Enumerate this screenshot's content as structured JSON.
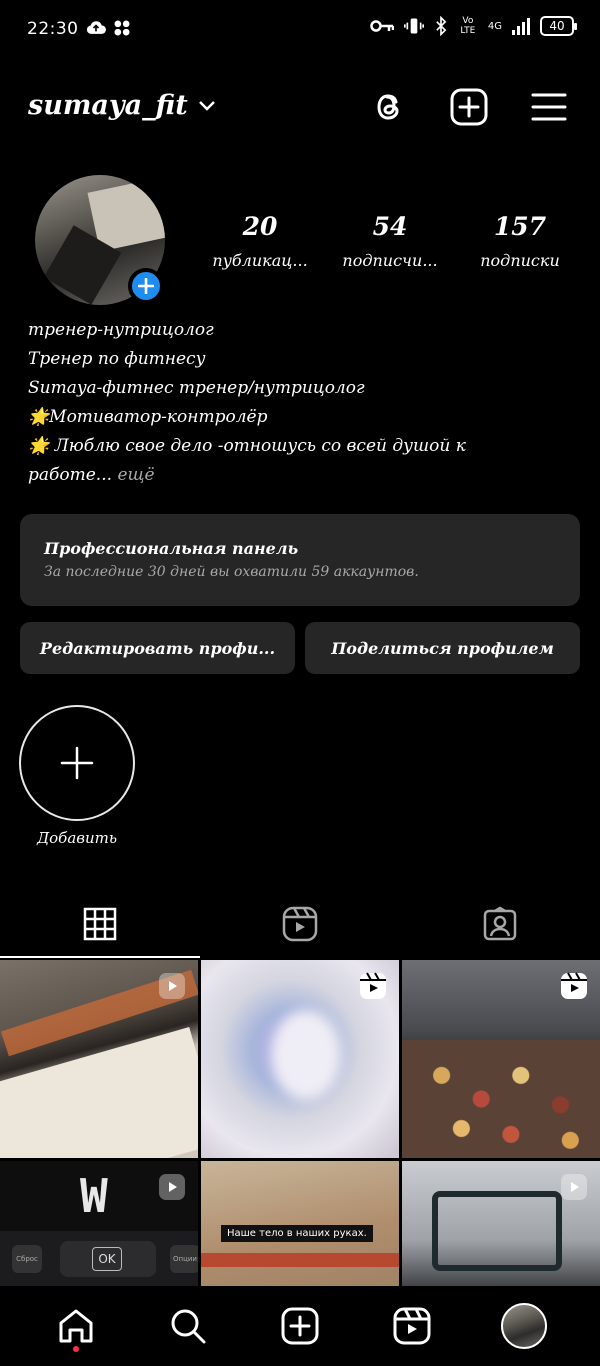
{
  "status_bar": {
    "time": "22:30",
    "network_type": "4G",
    "volte": "Vo LTE",
    "battery": "40"
  },
  "header": {
    "username": "sumaya_fit",
    "icons": [
      "threads-icon",
      "new-post-icon",
      "menu-icon"
    ]
  },
  "profile": {
    "stats": [
      {
        "value": "20",
        "label": "публикац..."
      },
      {
        "value": "54",
        "label": "подписчи..."
      },
      {
        "value": "157",
        "label": "подписки"
      }
    ],
    "bio": {
      "lines": [
        "тренер-нутрицолог",
        "Тренер по фитнесу",
        "Sumaya-фитнес тренер/нутрицолог",
        "🌟Мотиватор-контролёр",
        "🌟 Люблю свое дело -отношусь со всей душой к",
        "работе..."
      ],
      "more": "ещё"
    }
  },
  "pro_panel": {
    "title": "Профессиональная панель",
    "subtitle": "За последние 30 дней вы охватили 59 аккаунтов."
  },
  "actions": {
    "edit": "Редактировать профи...",
    "share": "Поделиться профилем"
  },
  "highlights": {
    "add_label": "Добавить"
  },
  "tabs": [
    "grid-icon",
    "reels-icon",
    "tagged-icon"
  ],
  "grid": {
    "cell4_ok": "OK",
    "cell4_left": "Сброс",
    "cell4_right": "Опции",
    "cell4_screen": "W",
    "cell5_caption": "Наше тело в наших руках."
  },
  "bottom_nav": [
    "home-icon",
    "search-icon",
    "create-icon",
    "reels-icon",
    "profile-avatar"
  ],
  "colors": {
    "background": "#000000",
    "panel": "#262626",
    "accent_blue": "#1f8cf0",
    "notification_red": "#ff3040",
    "muted_text": "#a8a8a8"
  }
}
